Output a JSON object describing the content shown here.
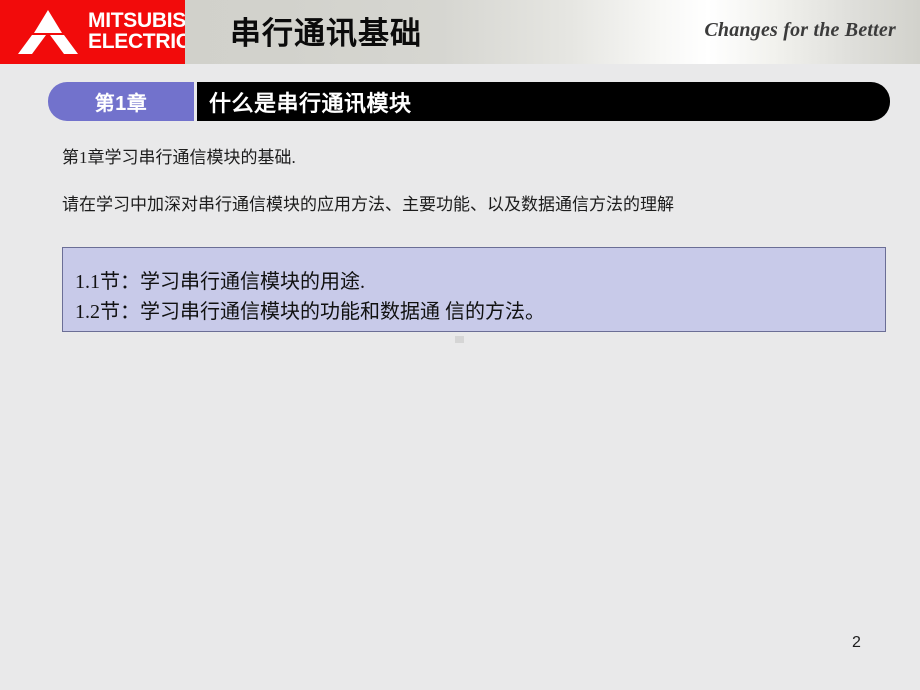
{
  "header": {
    "logo": {
      "icon": "mitsubishi-three-diamonds",
      "line1": "MITSUBISHI",
      "line2": "ELECTRIC",
      "background_color": "#f20b0b"
    },
    "title": "串行通讯基础",
    "tagline": "Changes for the Better"
  },
  "chapter": {
    "badge_label": "第1章",
    "badge_color": "#7272cc",
    "heading": "什么是串行通讯模块",
    "heading_bar_color": "#000000"
  },
  "body": {
    "paragraphs": [
      "第1章学习串行通信模块的基础.",
      "请在学习中加深对串行通信模块的应用方法、主要功能、以及数据通信方法的理解"
    ]
  },
  "highlight_box": {
    "background_color": "#c8cae9",
    "border_color": "#6b6e96",
    "lines": [
      "1.1节：学习串行通信模块的用途.",
      "1.2节：学习串行通信模块的功能和数据通 信的方法。"
    ]
  },
  "footer": {
    "page_number": "2"
  }
}
